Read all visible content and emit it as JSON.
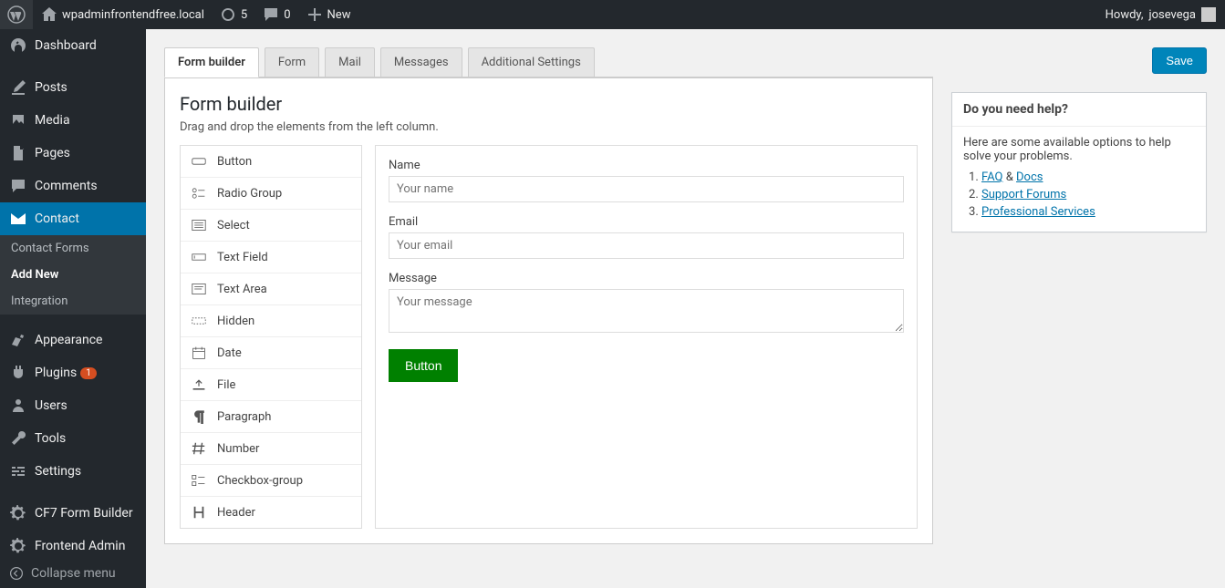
{
  "adminbar": {
    "site_name": "wpadminfrontendfree.local",
    "updates_count": "5",
    "comments_count": "0",
    "new_label": "New",
    "howdy_prefix": "Howdy, ",
    "username": "josevega"
  },
  "sidebar": {
    "items": [
      {
        "label": "Dashboard",
        "icon": "dashboard"
      },
      {
        "label": "Posts",
        "icon": "posts"
      },
      {
        "label": "Media",
        "icon": "media"
      },
      {
        "label": "Pages",
        "icon": "pages"
      },
      {
        "label": "Comments",
        "icon": "comments"
      },
      {
        "label": "Contact",
        "icon": "contact",
        "current": true,
        "submenu": [
          "Contact Forms",
          "Add New",
          "Integration"
        ],
        "submenu_active": 1
      },
      {
        "label": "Appearance",
        "icon": "appearance"
      },
      {
        "label": "Plugins",
        "icon": "plugins",
        "badge": "1"
      },
      {
        "label": "Users",
        "icon": "users"
      },
      {
        "label": "Tools",
        "icon": "tools"
      },
      {
        "label": "Settings",
        "icon": "settings"
      },
      {
        "label": "CF7 Form Builder",
        "icon": "gear"
      },
      {
        "label": "Frontend Admin",
        "icon": "gear"
      }
    ],
    "collapse_label": "Collapse menu"
  },
  "tabs": [
    "Form builder",
    "Form",
    "Mail",
    "Messages",
    "Additional Settings"
  ],
  "tabs_active": 0,
  "builder": {
    "title": "Form builder",
    "desc": "Drag and drop the elements from the left column.",
    "elements": [
      "Button",
      "Radio Group",
      "Select",
      "Text Field",
      "Text Area",
      "Hidden",
      "Date",
      "File",
      "Paragraph",
      "Number",
      "Checkbox-group",
      "Header"
    ],
    "form": {
      "name_label": "Name",
      "name_placeholder": "Your name",
      "email_label": "Email",
      "email_placeholder": "Your email",
      "message_label": "Message",
      "message_placeholder": "Your message",
      "button_label": "Button"
    }
  },
  "side": {
    "save": "Save",
    "help_title": "Do you need help?",
    "help_intro": "Here are some available options to help solve your problems.",
    "faq": "FAQ",
    "amp": " & ",
    "docs": "Docs",
    "support": "Support Forums",
    "pro": "Professional Services"
  }
}
